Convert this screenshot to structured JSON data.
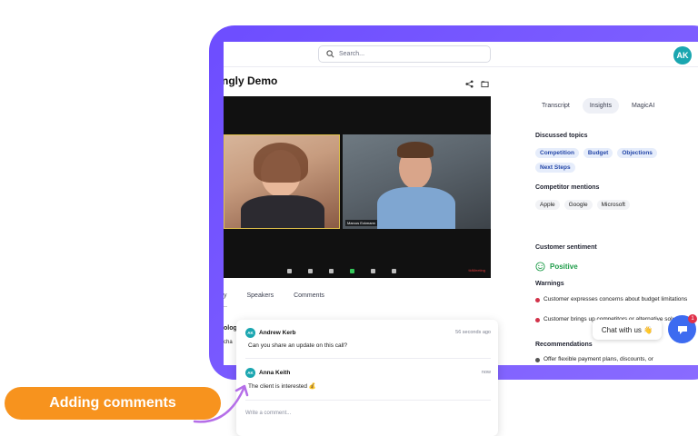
{
  "search": {
    "placeholder": "Search..."
  },
  "user": {
    "initials": "AK"
  },
  "meeting": {
    "title": "ngly Demo"
  },
  "video": {
    "participant_b_name": "Marcus Eckmann",
    "brand_text": "tldMeeting"
  },
  "under_video_tabs": [
    {
      "label": "y"
    },
    {
      "label": "Speakers"
    },
    {
      "label": "Comments"
    }
  ],
  "left_fragments": {
    "line1": "olog",
    "line2": "cha"
  },
  "right_tabs": [
    {
      "label": "Transcript"
    },
    {
      "label": "Insights"
    },
    {
      "label": "MagicAI"
    }
  ],
  "discussed": {
    "label": "Discussed topics",
    "topics": [
      "Competition",
      "Budget",
      "Objections",
      "Next Steps"
    ]
  },
  "competitors": {
    "label": "Competitor mentions",
    "names": [
      "Apple",
      "Google",
      "Microsoft"
    ]
  },
  "sentiment": {
    "label": "Customer sentiment",
    "value": "Positive"
  },
  "warnings": {
    "label": "Warnings",
    "items": [
      "Customer expresses concerns about budget limitations",
      "Customer brings up competitors or alternative solutions"
    ]
  },
  "recommendations": {
    "label": "Recommendations",
    "first": "Offer flexible payment plans, discounts, or"
  },
  "chat": {
    "label": "Chat with us 👋",
    "badge": "1"
  },
  "comments": [
    {
      "initials": "AK",
      "author": "Andrew Kerb",
      "time": "56 seconds ago",
      "text": "Can you share an update on this call?"
    },
    {
      "initials": "AK",
      "author": "Anna Keith",
      "time": "now",
      "text": "The client is interested 💰"
    }
  ],
  "comment_input": {
    "placeholder": "Write a comment..."
  },
  "callout": {
    "label": "Adding comments"
  },
  "colors": {
    "frame": "#7b5cff",
    "accent_orange": "#f7931e",
    "avatar": "#1aa6b0",
    "positive": "#1e9c49",
    "warning": "#d2334a",
    "chat_button": "#3d6bf0"
  }
}
